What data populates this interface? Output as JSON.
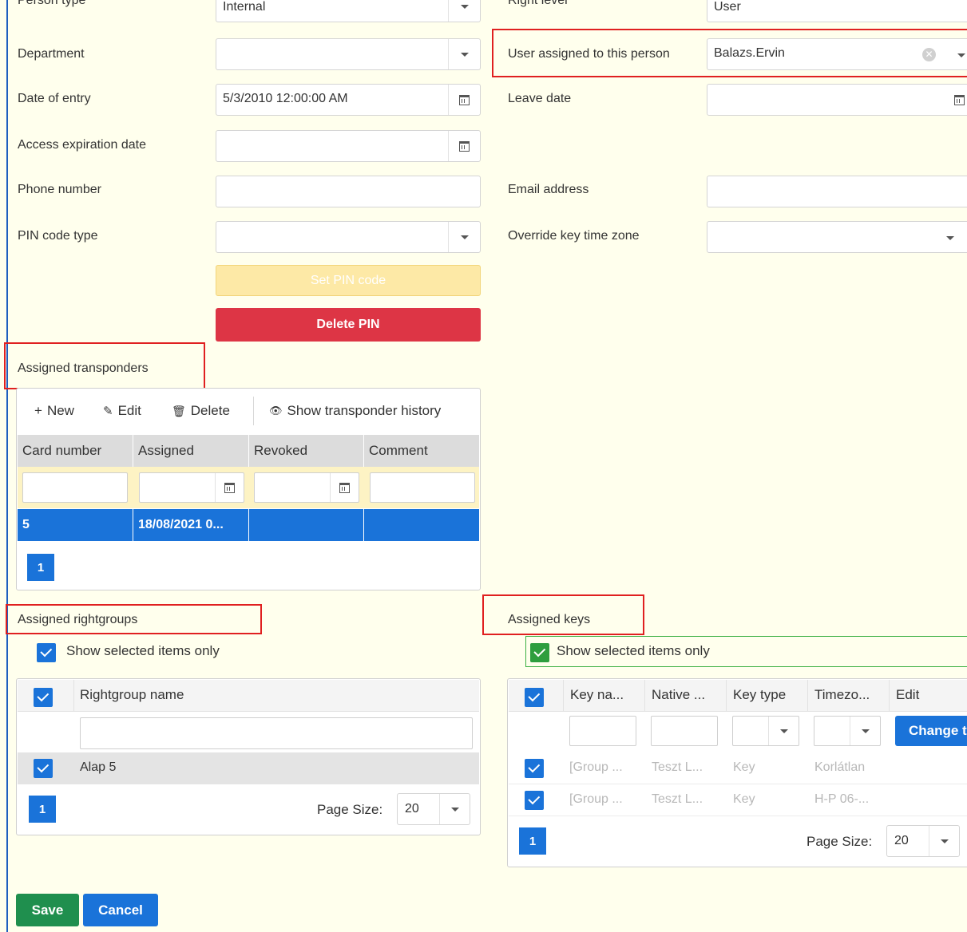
{
  "form": {
    "person_type_label": "Person type",
    "person_type_value": "Internal",
    "right_level_label": "Right level",
    "right_level_value": "User",
    "department_label": "Department",
    "department_value": "",
    "user_assigned_label": "User assigned to this person",
    "user_assigned_value": "Balazs.Ervin",
    "date_of_entry_label": "Date of entry",
    "date_of_entry_value": "5/3/2010 12:00:00 AM",
    "leave_date_label": "Leave date",
    "leave_date_value": "",
    "access_expiration_label": "Access expiration date",
    "access_expiration_value": "",
    "phone_label": "Phone number",
    "phone_value": "",
    "email_label": "Email address",
    "email_value": "",
    "pin_type_label": "PIN code type",
    "pin_type_value": "",
    "override_tz_label": "Override key time zone",
    "override_tz_value": "",
    "set_pin_label": "Set PIN code",
    "delete_pin_label": "Delete PIN"
  },
  "transponders": {
    "section_title": "Assigned transponders",
    "toolbar": {
      "new": "New",
      "edit": "Edit",
      "delete": "Delete",
      "history": "Show transponder history"
    },
    "columns": [
      "Card number",
      "Assigned",
      "Revoked",
      "Comment"
    ],
    "rows": [
      {
        "card": "5",
        "assigned": "18/08/2021 0...",
        "revoked": "",
        "comment": ""
      }
    ],
    "page": "1"
  },
  "rightgroups": {
    "section_title": "Assigned rightgroups",
    "show_selected": "Show selected items only",
    "column": "Rightgroup name",
    "rows": [
      {
        "name": "Alap 5"
      }
    ],
    "page": "1",
    "page_size_label": "Page Size:",
    "page_size_value": "20"
  },
  "keys": {
    "section_title": "Assigned keys",
    "show_selected": "Show selected items only",
    "columns": [
      "Key na...",
      "Native ...",
      "Key type",
      "Timezo...",
      "Edit"
    ],
    "change_button": "Change t",
    "rows": [
      {
        "name": "[Group ...",
        "native": "Teszt L...",
        "type": "Key",
        "tz": "Korlátlan"
      },
      {
        "name": "[Group ...",
        "native": "Teszt L...",
        "type": "Key",
        "tz": "H-P 06-..."
      }
    ],
    "page": "1",
    "page_size_label": "Page Size:",
    "page_size_value": "20"
  },
  "footer": {
    "save": "Save",
    "cancel": "Cancel"
  },
  "colors": {
    "background": "#ffffed",
    "primary": "#1a73d9",
    "danger": "#dd3545",
    "success": "#1f8f4e",
    "highlight_box": "#e02020"
  }
}
